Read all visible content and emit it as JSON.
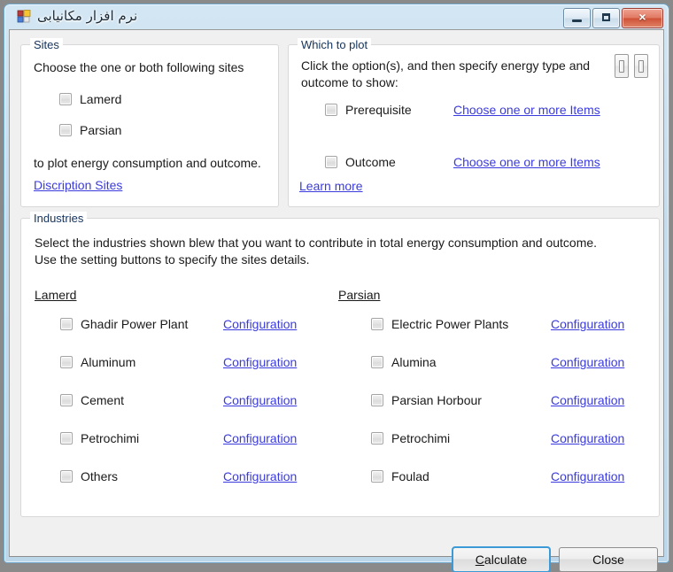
{
  "window": {
    "title": "نرم افزار مکانیابی",
    "icon": "app-icon",
    "buttons": {
      "minimize": "minimize",
      "maximize": "maximize",
      "close": "×"
    }
  },
  "sites_group": {
    "legend": "Sites",
    "instruction": "Choose the one or both following sites",
    "checkboxes": [
      {
        "label": "Lamerd",
        "checked": false
      },
      {
        "label": "Parsian",
        "checked": false
      }
    ],
    "footnote": "to plot energy consumption and outcome.",
    "link": "Discription Sites"
  },
  "plot_group": {
    "legend": "Which to plot",
    "instruction_line1": "Click the option(s), and then specify energy type and",
    "instruction_line2": "outcome to show:",
    "options": [
      {
        "label": "Prerequisite",
        "checked": false,
        "link": "Choose one or more Items"
      },
      {
        "label": "Outcome",
        "checked": false,
        "link": "Choose one or more Items"
      }
    ],
    "learn_more": "Learn more",
    "mini_buttons": [
      {
        "name": "settings-button-1"
      },
      {
        "name": "settings-button-2"
      }
    ]
  },
  "industries_group": {
    "legend": "Industries",
    "instruction_line1": "Select the industries shown blew that you want to contribute in total energy consumption and outcome.",
    "instruction_line2": "Use the setting buttons to specify the sites details.",
    "columns": [
      {
        "heading": "Lamerd",
        "rows": [
          {
            "label": "Ghadir Power Plant",
            "checked": false,
            "link": "Configuration"
          },
          {
            "label": "Aluminum",
            "checked": false,
            "link": "Configuration"
          },
          {
            "label": "Cement",
            "checked": false,
            "link": "Configuration"
          },
          {
            "label": "Petrochimi",
            "checked": false,
            "link": "Configuration"
          },
          {
            "label": "Others",
            "checked": false,
            "link": "Configuration"
          }
        ]
      },
      {
        "heading": "Parsian",
        "rows": [
          {
            "label": "Electric Power Plants",
            "checked": false,
            "link": "Configuration"
          },
          {
            "label": "Alumina",
            "checked": false,
            "link": "Configuration"
          },
          {
            "label": "Parsian Horbour",
            "checked": false,
            "link": "Configuration"
          },
          {
            "label": "Petrochimi",
            "checked": false,
            "link": "Configuration"
          },
          {
            "label": "Foulad",
            "checked": false,
            "link": "Configuration"
          }
        ]
      }
    ]
  },
  "footer": {
    "calculate": {
      "accel": "C",
      "rest": "alculate"
    },
    "close": "Close"
  },
  "colors": {
    "link": "#3b3bdd",
    "legend": "#14335c",
    "accent": "#3c9bd6",
    "close_button": "#cf5136"
  }
}
